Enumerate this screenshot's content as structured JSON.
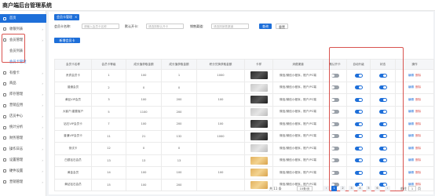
{
  "app": {
    "title": "商户端后台管理系统"
  },
  "sidebar": {
    "items": [
      {
        "label": "首页",
        "active": true
      },
      {
        "label": "收银列表"
      },
      {
        "label": "会员管理",
        "open": true
      },
      {
        "label": "会员列表",
        "sub": true
      },
      {
        "label": "会员卡管理",
        "sub": true,
        "current": true
      },
      {
        "label": "有偿卡"
      },
      {
        "label": "商品"
      },
      {
        "label": "库存管理"
      },
      {
        "label": "营销应用"
      },
      {
        "label": "店员中心"
      },
      {
        "label": "统计分析"
      },
      {
        "label": "财务管理"
      },
      {
        "label": "操作日志"
      },
      {
        "label": "设置管理"
      },
      {
        "label": "硬件设置"
      },
      {
        "label": "营销管理"
      }
    ]
  },
  "tab": {
    "label": "会员卡管理",
    "close": "×"
  },
  "filters": {
    "name_label": "会员卡名称:",
    "name_placeholder": "请输入会员卡名称",
    "status_label": "默认开卡:",
    "status_placeholder": "请选择默认开卡",
    "channel_label": "销售渠道:",
    "channel_placeholder": "请选择销售渠道",
    "search_button": "查询",
    "reset_button": "重置"
  },
  "add_button": "新增会员卡",
  "table": {
    "headers": [
      "会员卡名称",
      "会员卡等级",
      "成长值获取金额",
      "成长值获取金额",
      "积分兑换获取金额",
      "卡样",
      "消费渠道",
      "默认开卡",
      "自动升级",
      "状态",
      "操作"
    ],
    "rows": [
      {
        "name": "贵宾会员卡",
        "level": "1",
        "g1": "100",
        "g2": "1",
        "points": "1000",
        "card": "dark",
        "channel": "微信/微信小程序，账户/PC端",
        "default": false,
        "auto": true,
        "status": true
      },
      {
        "name": "普通会员",
        "level": "2",
        "g1": "0",
        "g2": "0",
        "points": "",
        "card": "gray",
        "channel": "微信/微信小程序，账户/PC端",
        "default": false,
        "auto": true,
        "status": true
      },
      {
        "name": "黄钻VIP会员",
        "level": "3",
        "g1": "100",
        "g2": "200",
        "points": "100",
        "card": "dark",
        "channel": "微信/微信小程序，账户/PC端",
        "default": false,
        "auto": true,
        "status": true
      },
      {
        "name": "大客户/重要客户",
        "level": "5",
        "g1": "1100",
        "g2": "200",
        "points": "",
        "card": "gray",
        "channel": "微信/微信小程序，账户/PC端",
        "default": false,
        "auto": true,
        "status": true
      },
      {
        "name": "钻石VIP会员卡",
        "level": "7",
        "g1": "100",
        "g2": "200",
        "points": "100",
        "card": "dark",
        "channel": "微信/微信小程序，账户/PC端",
        "default": false,
        "auto": true,
        "status": true
      },
      {
        "name": "普通VIP会员卡",
        "level": "11",
        "g1": "21",
        "g2": "132",
        "points": "1000",
        "card": "dark",
        "channel": "微信/微信小程序，账户/PC端",
        "default": false,
        "auto": true,
        "status": true
      },
      {
        "name": "测试卡",
        "level": "12",
        "g1": "0",
        "g2": "0",
        "points": "",
        "card": "gray",
        "channel": "微信/微信小程序，账户/PC端",
        "default": false,
        "auto": true,
        "status": true
      },
      {
        "name": "白银钻石会员",
        "level": "13",
        "g1": "13",
        "g2": "13",
        "points": "",
        "card": "gold",
        "channel": "微信/微信小程序，账户/PC端",
        "default": false,
        "auto": true,
        "status": true
      },
      {
        "name": "黄金会员",
        "level": "14",
        "g1": "100",
        "g2": "100",
        "points": "100",
        "card": "gold",
        "channel": "微信/微信小程序，账户/PC端",
        "default": false,
        "auto": true,
        "status": true
      },
      {
        "name": "黄钻钻石会员",
        "level": "15",
        "g1": "100",
        "g2": "200",
        "points": "",
        "card": "gold",
        "channel": "微信/微信小程序，账户/PC端",
        "default": false,
        "auto": true,
        "status": true
      }
    ],
    "edit_label": "编辑",
    "delete_label": "删除"
  },
  "pagination": {
    "total": "共 11 条",
    "page_size": "10条/页",
    "prev": "‹",
    "next": "›",
    "pages": [
      "1",
      "2",
      "3",
      "4",
      "5",
      "6"
    ],
    "current": "1",
    "goto_label": "前往",
    "goto_value": "1",
    "goto_suffix": "页"
  },
  "colors": {
    "accent": "#1e6fd9",
    "highlight_box": "#d9534f"
  }
}
